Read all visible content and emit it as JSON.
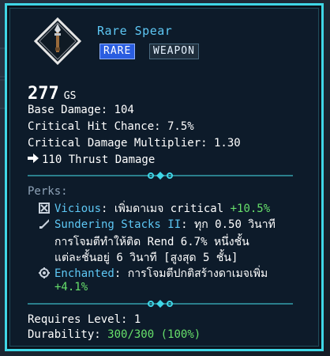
{
  "item": {
    "title": "Rare Spear",
    "rarity_tag": "RARE",
    "type_tag": "WEAPON",
    "gear_score": "277",
    "gear_score_unit": "GS"
  },
  "stats": {
    "base_damage": "Base Damage: 104",
    "crit_chance": "Critical Hit Chance: 7.5%",
    "crit_multiplier": "Critical Damage Multiplier: 1.30",
    "thrust": "110 Thrust Damage"
  },
  "perks": {
    "label": "Perks:",
    "items": [
      {
        "name": "Vicious",
        "sep": ":",
        "text": " เพิ่มดาเมจ critical ",
        "pct": "+10.5%",
        "cont": ""
      },
      {
        "name": "Sundering Stacks II",
        "sep": ":",
        "text": " ทุก 0.50 วินาที",
        "pct": "",
        "cont": [
          "การโจมตีทำให้ติด Rend 6.7% หนึ่งชั้น",
          "แต่ละชั้นอยู่ 6 วินาที [สูงสุด 5 ชั้น]"
        ]
      },
      {
        "name": "Enchanted",
        "sep": ":",
        "text": " การโจมตีปกติสร้างดาเมจเพิ่ม",
        "pct": "",
        "cont": [
          "+4.1%"
        ]
      }
    ]
  },
  "footer": {
    "requires": "Requires Level: 1",
    "durability_label": "Durability: ",
    "durability_value": "300/300",
    "durability_pct": "(100%)"
  },
  "colors": {
    "border": "#3fd6e6",
    "title": "#5ec8f5",
    "rare_tag": "#2a5de0",
    "positive": "#67e06b"
  },
  "icons": {
    "item": "spear-icon",
    "thrust": "arrow-right-icon",
    "perk1": "vicious-icon",
    "perk2": "sundering-icon",
    "perk3": "enchanted-icon",
    "divider": "ornament-divider-icon"
  }
}
